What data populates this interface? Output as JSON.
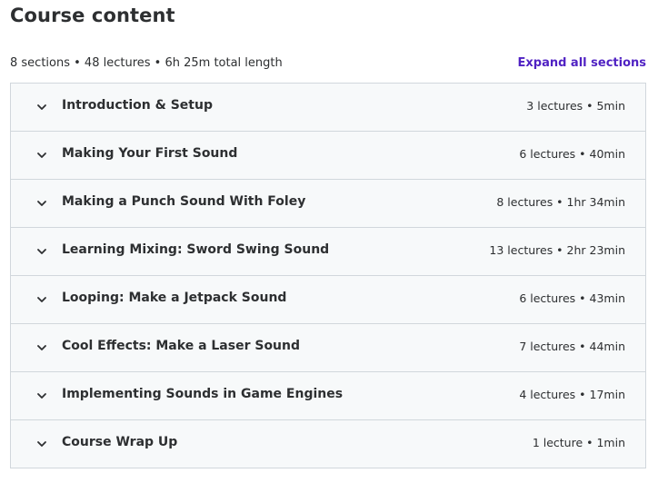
{
  "header": {
    "title": "Course content"
  },
  "summary": {
    "text": "8 sections • 48 lectures • 6h 25m total length",
    "expand_label": "Expand all sections"
  },
  "sections": [
    {
      "title": "Introduction & Setup",
      "meta": "3 lectures • 5min"
    },
    {
      "title": "Making Your First Sound",
      "meta": "6 lectures • 40min"
    },
    {
      "title": "Making a Punch Sound With Foley",
      "meta": "8 lectures • 1hr 34min"
    },
    {
      "title": "Learning Mixing: Sword Swing Sound",
      "meta": "13 lectures • 2hr 23min"
    },
    {
      "title": "Looping: Make a Jetpack Sound",
      "meta": "6 lectures • 43min"
    },
    {
      "title": "Cool Effects: Make a Laser Sound",
      "meta": "7 lectures • 44min"
    },
    {
      "title": "Implementing Sounds in Game Engines",
      "meta": "4 lectures • 17min"
    },
    {
      "title": "Course Wrap Up",
      "meta": "1 lecture • 1min"
    }
  ],
  "icons": {
    "section_toggle": "chevron-down-icon"
  },
  "colors": {
    "accent": "#5022c3",
    "text": "#2d2f31",
    "row_background": "#f7f9fa",
    "border": "#d1d7dc"
  }
}
